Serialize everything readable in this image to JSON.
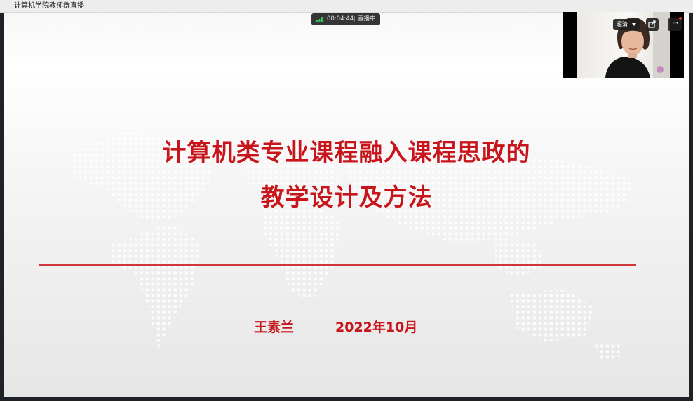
{
  "window": {
    "title": "计算机学院教师群直播"
  },
  "live_status": {
    "elapsed": "00:04:44",
    "state": "直播中"
  },
  "camera_controls": {
    "clarity_label": "超清",
    "more_label": "···"
  },
  "slide": {
    "title_line1": "计算机类专业课程融入课程思政的",
    "title_line2": "教学设计及方法",
    "author": "王素兰",
    "date": "2022年10月"
  },
  "colors": {
    "accent_red": "#c8151b",
    "live_green": "#3bc05a"
  }
}
